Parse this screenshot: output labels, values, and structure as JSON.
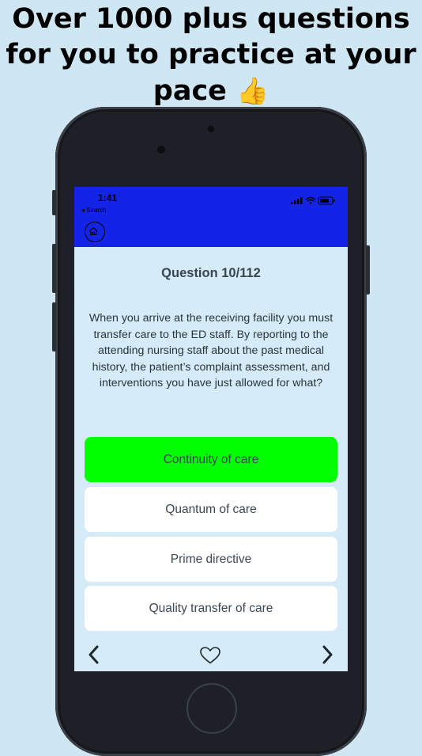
{
  "promo": {
    "line1": "Over 1000 plus questions",
    "line2": "for you to practice at your",
    "line3": "pace",
    "emoji": "👍"
  },
  "status": {
    "time": "1:41",
    "back_label": "◂ Search",
    "icons": [
      "signal-icon",
      "wifi-icon",
      "battery-icon"
    ]
  },
  "quiz": {
    "title": "Question 10/112",
    "question": "When you arrive at the receiving facility you must transfer care to the ED staff. By reporting to the attending nursing staff about the past medical history, the patient’s complaint assessment, and interventions you have just allowed for what?",
    "answers": [
      {
        "label": "Continuity of care",
        "state": "correct"
      },
      {
        "label": "Quantum of care",
        "state": "default"
      },
      {
        "label": "Prime directive",
        "state": "default"
      },
      {
        "label": "Quality transfer of care",
        "state": "default"
      }
    ]
  },
  "nav": {
    "icons": [
      "home-icon",
      "chevron-left-icon",
      "heart-icon",
      "chevron-right-icon"
    ]
  },
  "colors": {
    "background": "#cfe6f3",
    "header_blue": "#1424e6",
    "screen_bg": "#d6ebf8",
    "correct_green": "#00ff00",
    "phone_body": "#1d2026"
  }
}
